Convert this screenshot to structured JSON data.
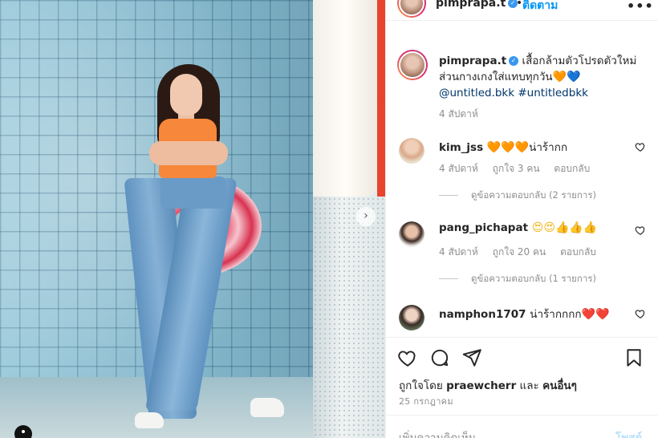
{
  "post": {
    "username": "pimprapa.t",
    "follow_label": "ติดตาม",
    "dot": "•",
    "more_label": "•••",
    "verified_mark": "✓",
    "caption_text": "เสื้อกล้ามตัวโปรดตัวใหม่ ส่วนกางเกงใส่แทบทุกวัน",
    "caption_emoji_1": "🧡",
    "caption_emoji_2": "💙",
    "caption_tags": "@untitled.bkk #untitledbkk",
    "caption_age": "4 สัปดาห์",
    "carousel_next": "›"
  },
  "comments": [
    {
      "user": "kim_jss",
      "emoji": "🧡🧡🧡",
      "text": "น่าร้ากก",
      "age": "4 สัปดาห์",
      "likes": "ถูกใจ 3 คน",
      "reply": "ตอบกลับ",
      "view_replies": "ดูข้อความตอบกลับ (2 รายการ)"
    },
    {
      "user": "pang_pichapat",
      "emoji": "😍😍👍👍👍",
      "text": "",
      "age": "4 สัปดาห์",
      "likes": "ถูกใจ 20 คน",
      "reply": "ตอบกลับ",
      "view_replies": "ดูข้อความตอบกลับ (1 รายการ)"
    },
    {
      "user": "namphon1707",
      "emoji": "❤️❤️",
      "text": "น่าร้ากกกก",
      "age": "",
      "likes": "",
      "reply": "",
      "view_replies": ""
    }
  ],
  "footer": {
    "liked_prefix": "ถูกใจโดย",
    "liked_user": "praewcherr",
    "liked_and": "และ",
    "liked_others": "คนอื่นๆ",
    "date": "25 กรกฎาคม",
    "comment_placeholder": "เพิ่มความคิดเห็น...",
    "post_button": "โพสต์"
  },
  "icons": {
    "like": "heart-icon",
    "comment": "comment-icon",
    "share": "share-icon",
    "save": "bookmark-icon",
    "comment_like": "heart-icon",
    "more": "more-icon",
    "next": "chevron-right-icon"
  },
  "colors": {
    "link_blue": "#0095f6",
    "tag_blue": "#00376b",
    "verified_blue": "#3897f0",
    "secondary_text": "#8e8e8e",
    "post_button_disabled": "#b2dffc"
  }
}
